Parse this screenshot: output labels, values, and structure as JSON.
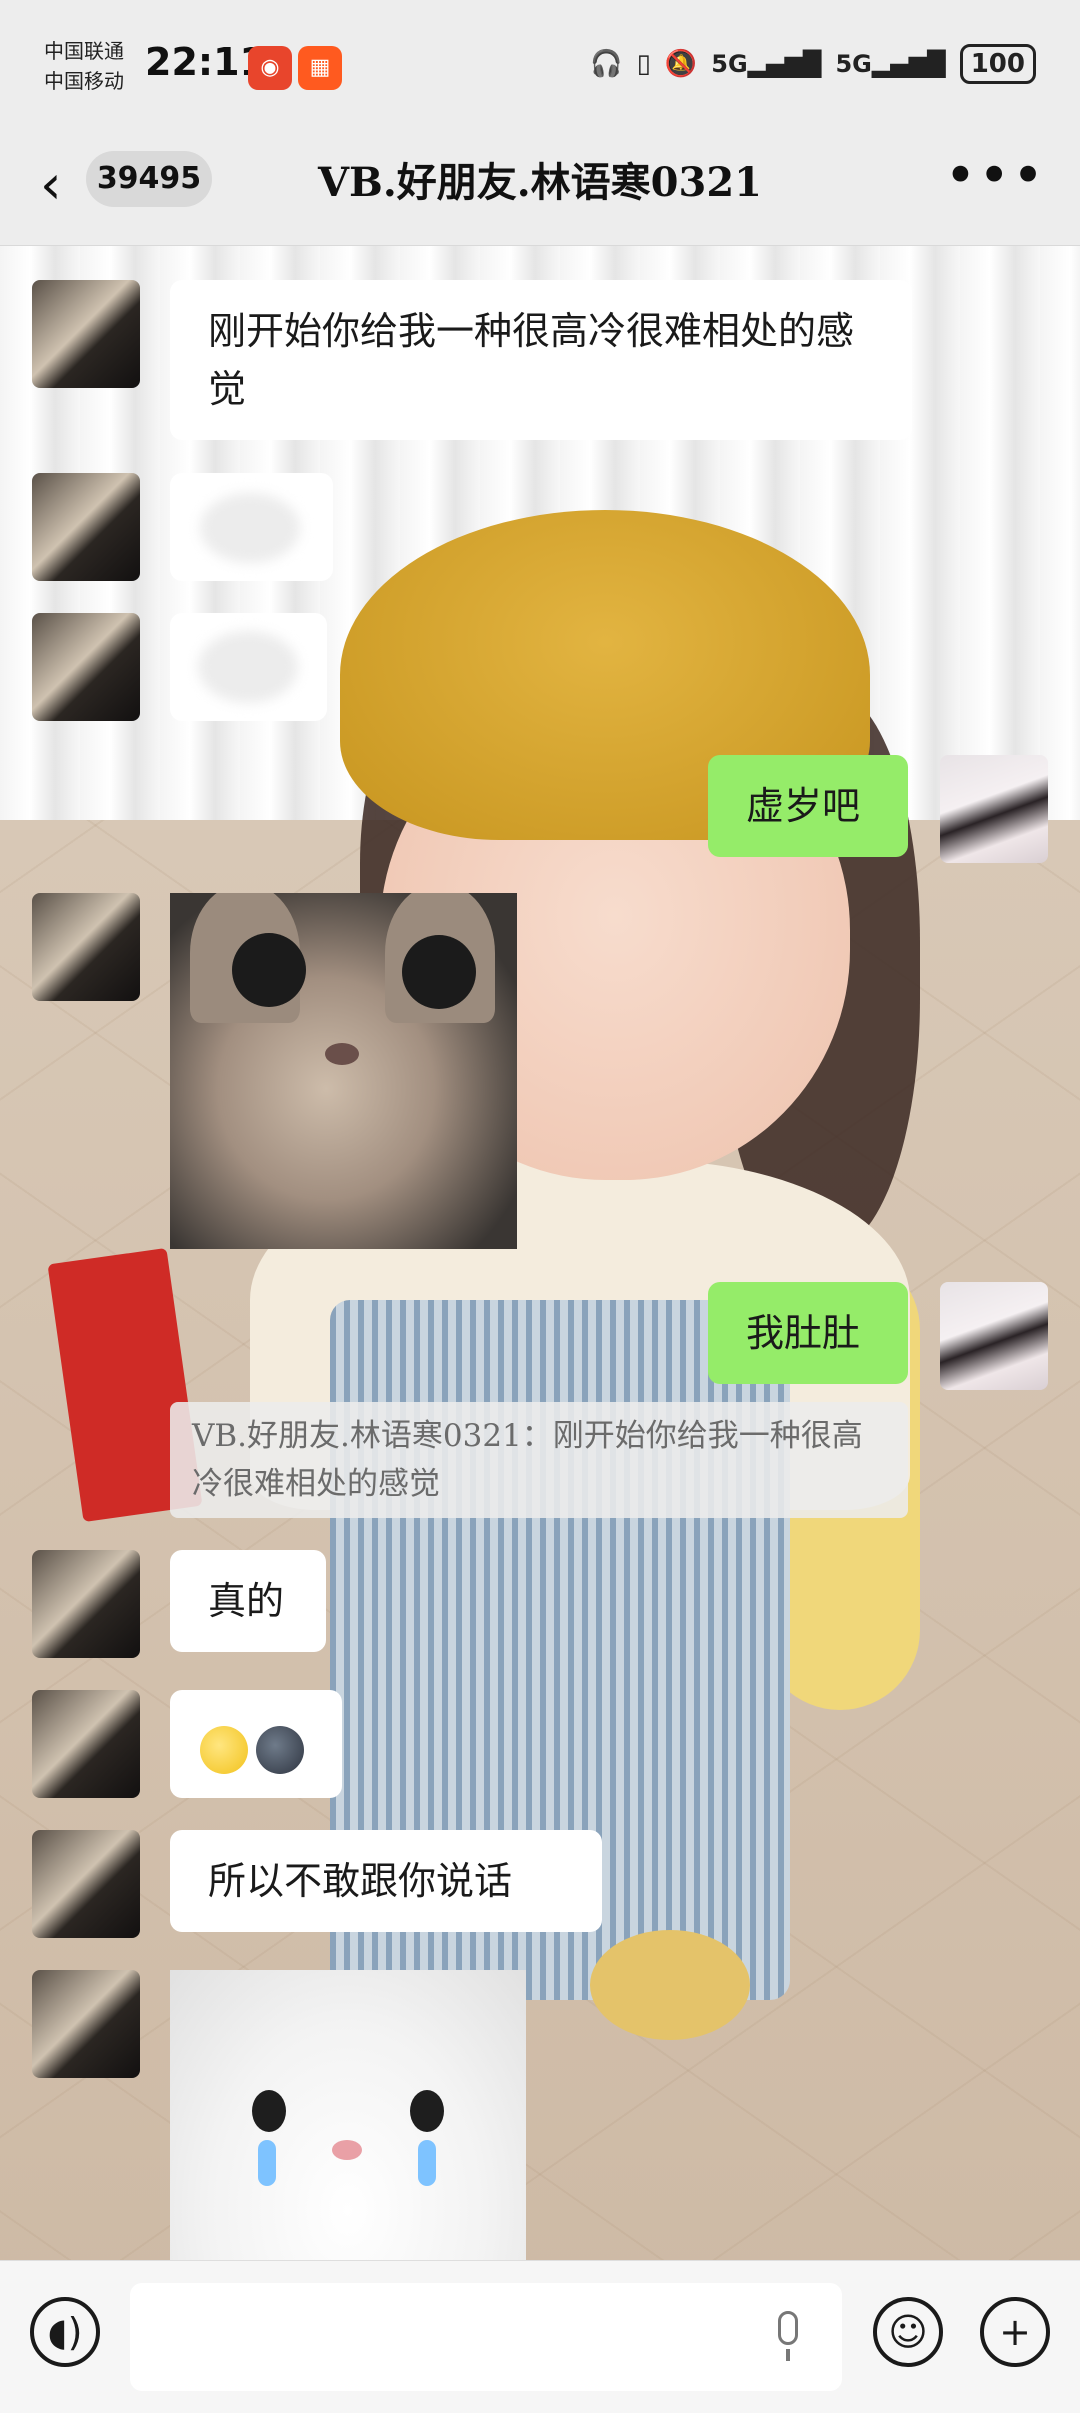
{
  "status_bar": {
    "carrier_1": "中国联通",
    "carrier_2": "中国移动",
    "time": "22:11",
    "signal_1": "5G",
    "signal_2": "5G",
    "battery": "100"
  },
  "header": {
    "back_icon": "chevron-left",
    "unread_count": "39495",
    "title": "VB.好朋友.林语寒0321",
    "more_icon": "more-horizontal"
  },
  "messages": [
    {
      "side": "left",
      "type": "text",
      "text": "刚开始你给我一种很高冷很难相处的感觉"
    },
    {
      "side": "left",
      "type": "blurred",
      "text": ""
    },
    {
      "side": "left",
      "type": "blurred",
      "text": ""
    },
    {
      "side": "right",
      "type": "text",
      "text": "虚岁吧"
    },
    {
      "side": "left",
      "type": "image",
      "image": "cat-photo"
    },
    {
      "side": "right",
      "type": "text",
      "text": "我肚肚"
    },
    {
      "side": "right",
      "type": "quote",
      "text": "VB.好朋友.林语寒0321：刚开始你给我一种很高冷很难相处的感觉"
    },
    {
      "side": "left",
      "type": "text",
      "text": "真的"
    },
    {
      "side": "left",
      "type": "emoji",
      "emojis": [
        "full-moon-face",
        "new-moon-face"
      ]
    },
    {
      "side": "left",
      "type": "text",
      "text": "所以不敢跟你说话"
    },
    {
      "side": "left",
      "type": "image",
      "image": "crying-rabbit-sticker"
    }
  ],
  "input_bar": {
    "voice_icon": "voice-wave",
    "message_placeholder": "",
    "mic_icon": "microphone",
    "emoji_icon": "smiley",
    "plus_icon": "plus"
  },
  "colors": {
    "sent_bubble": "#95ec69",
    "received_bubble": "#ffffff",
    "bar_background": "#ededed"
  }
}
